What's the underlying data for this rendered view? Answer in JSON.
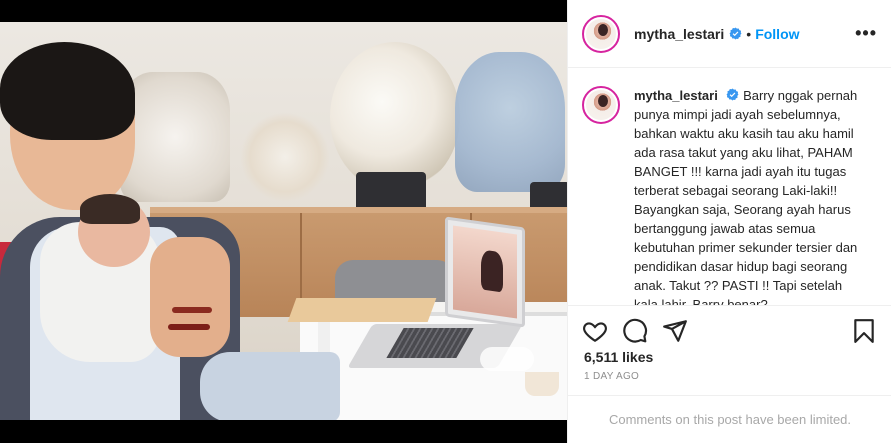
{
  "post": {
    "username": "mytha_lestari",
    "follow_label": "Follow",
    "separator": "•",
    "more_label": "•••",
    "caption": "Barry nggak pernah punya mimpi jadi ayah sebelumnya, bahkan waktu aku kasih tau aku hamil ada rasa takut yang aku lihat, PAHAM BANGET !!! karna jadi ayah itu tugas terberat sebagai seorang Laki-laki!! Bayangkan saja, Seorang ayah harus bertanggung jawab atas semua kebutuhan primer sekunder tersier dan pendidikan dasar hidup bagi seorang anak. Takut ?? PASTI !! Tapi setelah kala lahir, Barry benar?",
    "likes": "6,511 likes",
    "date": "1 DAY AGO",
    "comments_notice": "Comments on this post have been limited.",
    "carousel": {
      "count": 3,
      "active": 0
    }
  },
  "colors": {
    "accent": "#0095f6",
    "verified": "#3897f0",
    "ring": "#d6249f"
  },
  "icons": [
    "verified-badge-icon",
    "heart-icon",
    "comment-icon",
    "share-icon",
    "bookmark-icon",
    "more-options-icon"
  ]
}
